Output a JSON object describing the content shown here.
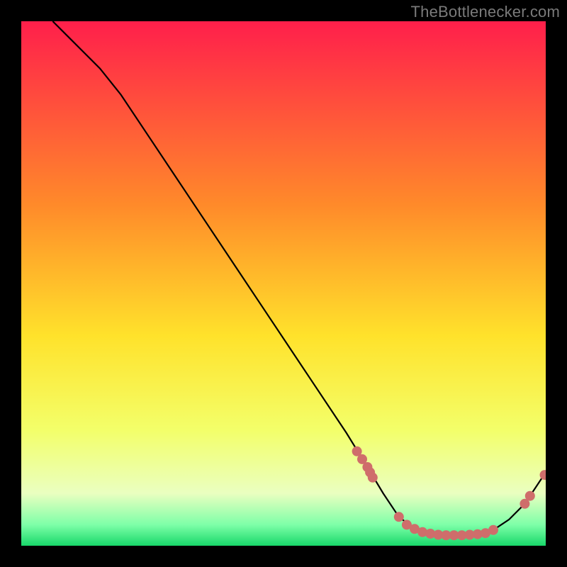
{
  "attribution": "TheBottlenecker.com",
  "palette": {
    "marker": "#cf6d6b",
    "curve": "#000000",
    "bg_black": "#000000",
    "grad_top": "#ff1f4b",
    "grad_upper_mid": "#ff8a2a",
    "grad_mid": "#ffe22b",
    "grad_lower_mid": "#f3ff6a",
    "grad_pale": "#eaffc0",
    "grad_green_light": "#7effa8",
    "grad_green": "#18d86a"
  },
  "chart_data": {
    "type": "line",
    "title": "",
    "xlabel": "",
    "ylabel": "",
    "xlim": [
      0,
      100
    ],
    "ylim": [
      0,
      100
    ],
    "curve": [
      {
        "x": 6,
        "y": 100
      },
      {
        "x": 9,
        "y": 97
      },
      {
        "x": 12,
        "y": 94
      },
      {
        "x": 15,
        "y": 91
      },
      {
        "x": 19,
        "y": 86
      },
      {
        "x": 25,
        "y": 77
      },
      {
        "x": 35,
        "y": 62
      },
      {
        "x": 45,
        "y": 47
      },
      {
        "x": 55,
        "y": 32
      },
      {
        "x": 62,
        "y": 21.5
      },
      {
        "x": 66,
        "y": 15
      },
      {
        "x": 69,
        "y": 10
      },
      {
        "x": 72,
        "y": 5.5
      },
      {
        "x": 75,
        "y": 3.2
      },
      {
        "x": 78,
        "y": 2.2
      },
      {
        "x": 82,
        "y": 2
      },
      {
        "x": 86,
        "y": 2.2
      },
      {
        "x": 90,
        "y": 3
      },
      {
        "x": 93,
        "y": 5
      },
      {
        "x": 96,
        "y": 8
      },
      {
        "x": 98,
        "y": 11
      },
      {
        "x": 100,
        "y": 14
      }
    ],
    "markers": [
      {
        "x": 64,
        "y": 18
      },
      {
        "x": 65,
        "y": 16.5
      },
      {
        "x": 66,
        "y": 15
      },
      {
        "x": 66.5,
        "y": 14
      },
      {
        "x": 67,
        "y": 13
      },
      {
        "x": 72,
        "y": 5.5
      },
      {
        "x": 73.5,
        "y": 4
      },
      {
        "x": 75,
        "y": 3.2
      },
      {
        "x": 76.5,
        "y": 2.6
      },
      {
        "x": 78,
        "y": 2.3
      },
      {
        "x": 79.5,
        "y": 2.1
      },
      {
        "x": 81,
        "y": 2.0
      },
      {
        "x": 82.5,
        "y": 2.0
      },
      {
        "x": 84,
        "y": 2.0
      },
      {
        "x": 85.5,
        "y": 2.1
      },
      {
        "x": 87,
        "y": 2.2
      },
      {
        "x": 88.5,
        "y": 2.4
      },
      {
        "x": 90,
        "y": 3.0
      },
      {
        "x": 96,
        "y": 8
      },
      {
        "x": 97,
        "y": 9.5
      },
      {
        "x": 99.8,
        "y": 13.5
      }
    ],
    "gradient_area": true
  }
}
